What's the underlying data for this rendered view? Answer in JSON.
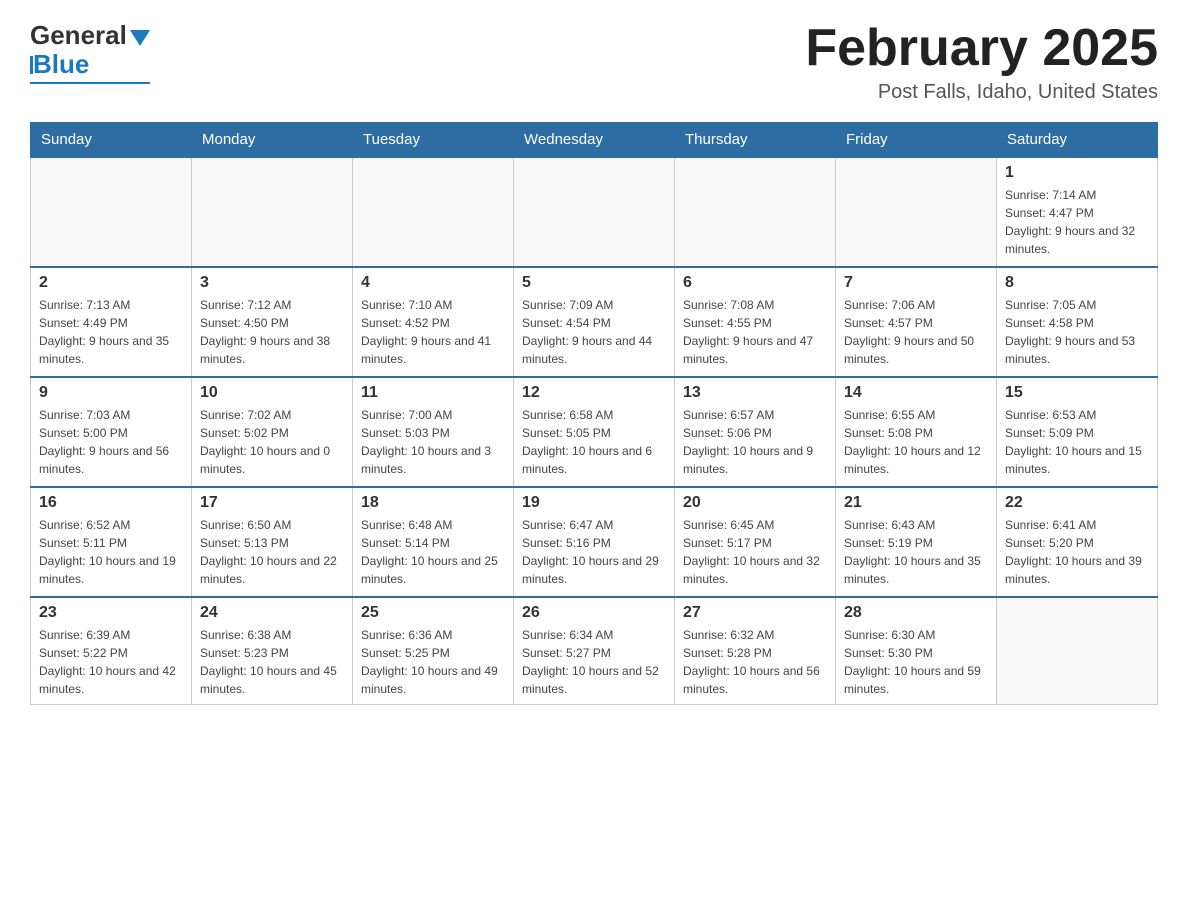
{
  "header": {
    "logo_general": "General",
    "logo_blue": "Blue",
    "month_title": "February 2025",
    "location": "Post Falls, Idaho, United States"
  },
  "calendar": {
    "days_of_week": [
      "Sunday",
      "Monday",
      "Tuesday",
      "Wednesday",
      "Thursday",
      "Friday",
      "Saturday"
    ],
    "weeks": [
      {
        "days": [
          {
            "date": "",
            "info": ""
          },
          {
            "date": "",
            "info": ""
          },
          {
            "date": "",
            "info": ""
          },
          {
            "date": "",
            "info": ""
          },
          {
            "date": "",
            "info": ""
          },
          {
            "date": "",
            "info": ""
          },
          {
            "date": "1",
            "info": "Sunrise: 7:14 AM\nSunset: 4:47 PM\nDaylight: 9 hours and 32 minutes."
          }
        ]
      },
      {
        "days": [
          {
            "date": "2",
            "info": "Sunrise: 7:13 AM\nSunset: 4:49 PM\nDaylight: 9 hours and 35 minutes."
          },
          {
            "date": "3",
            "info": "Sunrise: 7:12 AM\nSunset: 4:50 PM\nDaylight: 9 hours and 38 minutes."
          },
          {
            "date": "4",
            "info": "Sunrise: 7:10 AM\nSunset: 4:52 PM\nDaylight: 9 hours and 41 minutes."
          },
          {
            "date": "5",
            "info": "Sunrise: 7:09 AM\nSunset: 4:54 PM\nDaylight: 9 hours and 44 minutes."
          },
          {
            "date": "6",
            "info": "Sunrise: 7:08 AM\nSunset: 4:55 PM\nDaylight: 9 hours and 47 minutes."
          },
          {
            "date": "7",
            "info": "Sunrise: 7:06 AM\nSunset: 4:57 PM\nDaylight: 9 hours and 50 minutes."
          },
          {
            "date": "8",
            "info": "Sunrise: 7:05 AM\nSunset: 4:58 PM\nDaylight: 9 hours and 53 minutes."
          }
        ]
      },
      {
        "days": [
          {
            "date": "9",
            "info": "Sunrise: 7:03 AM\nSunset: 5:00 PM\nDaylight: 9 hours and 56 minutes."
          },
          {
            "date": "10",
            "info": "Sunrise: 7:02 AM\nSunset: 5:02 PM\nDaylight: 10 hours and 0 minutes."
          },
          {
            "date": "11",
            "info": "Sunrise: 7:00 AM\nSunset: 5:03 PM\nDaylight: 10 hours and 3 minutes."
          },
          {
            "date": "12",
            "info": "Sunrise: 6:58 AM\nSunset: 5:05 PM\nDaylight: 10 hours and 6 minutes."
          },
          {
            "date": "13",
            "info": "Sunrise: 6:57 AM\nSunset: 5:06 PM\nDaylight: 10 hours and 9 minutes."
          },
          {
            "date": "14",
            "info": "Sunrise: 6:55 AM\nSunset: 5:08 PM\nDaylight: 10 hours and 12 minutes."
          },
          {
            "date": "15",
            "info": "Sunrise: 6:53 AM\nSunset: 5:09 PM\nDaylight: 10 hours and 15 minutes."
          }
        ]
      },
      {
        "days": [
          {
            "date": "16",
            "info": "Sunrise: 6:52 AM\nSunset: 5:11 PM\nDaylight: 10 hours and 19 minutes."
          },
          {
            "date": "17",
            "info": "Sunrise: 6:50 AM\nSunset: 5:13 PM\nDaylight: 10 hours and 22 minutes."
          },
          {
            "date": "18",
            "info": "Sunrise: 6:48 AM\nSunset: 5:14 PM\nDaylight: 10 hours and 25 minutes."
          },
          {
            "date": "19",
            "info": "Sunrise: 6:47 AM\nSunset: 5:16 PM\nDaylight: 10 hours and 29 minutes."
          },
          {
            "date": "20",
            "info": "Sunrise: 6:45 AM\nSunset: 5:17 PM\nDaylight: 10 hours and 32 minutes."
          },
          {
            "date": "21",
            "info": "Sunrise: 6:43 AM\nSunset: 5:19 PM\nDaylight: 10 hours and 35 minutes."
          },
          {
            "date": "22",
            "info": "Sunrise: 6:41 AM\nSunset: 5:20 PM\nDaylight: 10 hours and 39 minutes."
          }
        ]
      },
      {
        "days": [
          {
            "date": "23",
            "info": "Sunrise: 6:39 AM\nSunset: 5:22 PM\nDaylight: 10 hours and 42 minutes."
          },
          {
            "date": "24",
            "info": "Sunrise: 6:38 AM\nSunset: 5:23 PM\nDaylight: 10 hours and 45 minutes."
          },
          {
            "date": "25",
            "info": "Sunrise: 6:36 AM\nSunset: 5:25 PM\nDaylight: 10 hours and 49 minutes."
          },
          {
            "date": "26",
            "info": "Sunrise: 6:34 AM\nSunset: 5:27 PM\nDaylight: 10 hours and 52 minutes."
          },
          {
            "date": "27",
            "info": "Sunrise: 6:32 AM\nSunset: 5:28 PM\nDaylight: 10 hours and 56 minutes."
          },
          {
            "date": "28",
            "info": "Sunrise: 6:30 AM\nSunset: 5:30 PM\nDaylight: 10 hours and 59 minutes."
          },
          {
            "date": "",
            "info": ""
          }
        ]
      }
    ]
  }
}
